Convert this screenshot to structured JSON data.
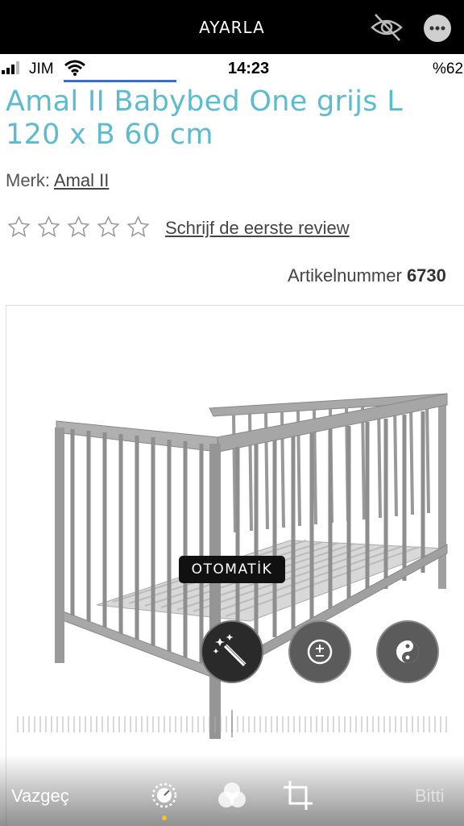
{
  "editor": {
    "title": "AYARLA",
    "tooltip": "OTOMATİK",
    "cancel_label": "Vazgeç",
    "done_label": "Bitti",
    "tools": [
      "auto-enhance",
      "exposure",
      "brilliance"
    ],
    "tabs": [
      "adjust",
      "filters",
      "crop"
    ]
  },
  "status_bar": {
    "carrier": "JIM",
    "time": "14:23",
    "battery": "%62"
  },
  "product": {
    "title": "Amal II Babybed One grijs L 120 x B 60 cm",
    "brand_label": "Merk:",
    "brand_name": "Amal II",
    "rating_stars": 5,
    "review_link": "Schrijf de eerste review",
    "article_label": "Artikelnummer",
    "article_number": "6730"
  },
  "colors": {
    "title_accent": "#5bbcd0",
    "active_indicator": "#f5c518"
  }
}
